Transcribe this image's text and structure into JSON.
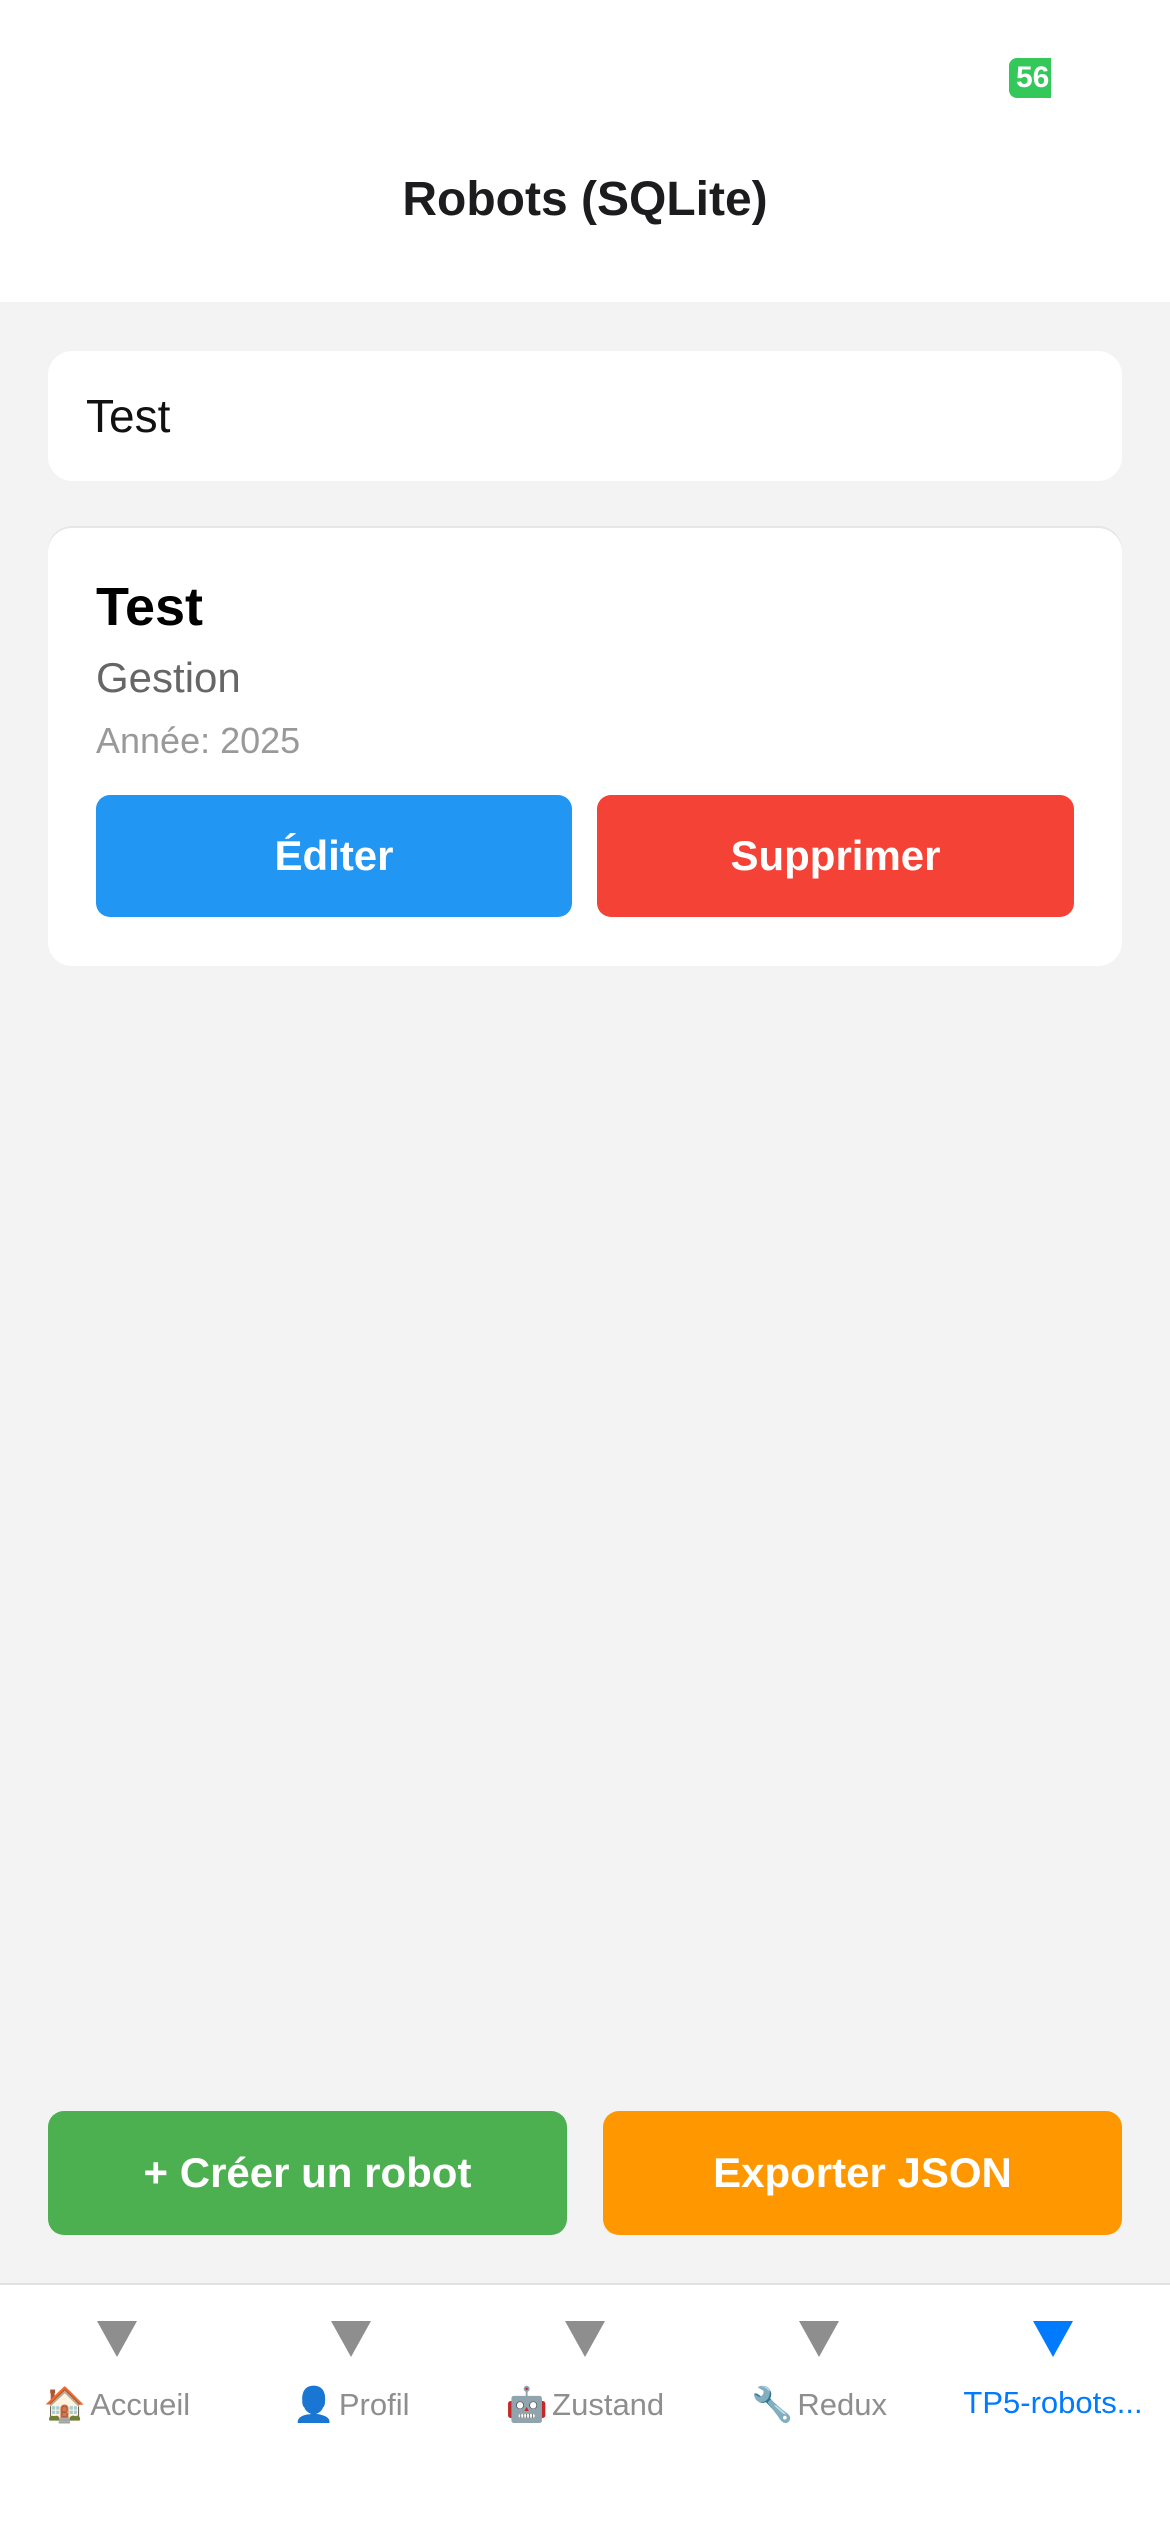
{
  "status_bar": {
    "battery": "56"
  },
  "header": {
    "title": "Robots (SQLite)"
  },
  "search": {
    "value": "Test",
    "placeholder": ""
  },
  "robots": [
    {
      "name": "Test",
      "type": "Gestion",
      "year_label": "Année: 2025"
    }
  ],
  "card_actions": {
    "edit_label": "Éditer",
    "delete_label": "Supprimer"
  },
  "actions": {
    "create_label": "+ Créer un robot",
    "export_label": "Exporter JSON"
  },
  "tabs": [
    {
      "icon": "🏠",
      "label": "Accueil",
      "active": false
    },
    {
      "icon": "👤",
      "label": "Profil",
      "active": false
    },
    {
      "icon": "🤖",
      "label": "Zustand",
      "active": false
    },
    {
      "icon": "🔧",
      "label": "Redux",
      "active": false
    },
    {
      "icon": "",
      "label": "TP5-robots...",
      "active": true
    }
  ],
  "colors": {
    "edit": "#2196f3",
    "delete": "#f44336",
    "create": "#4caf50",
    "export": "#ff9800",
    "active_tab": "#007aff",
    "inactive_tab": "#8e8e8e",
    "battery": "#34c759"
  }
}
